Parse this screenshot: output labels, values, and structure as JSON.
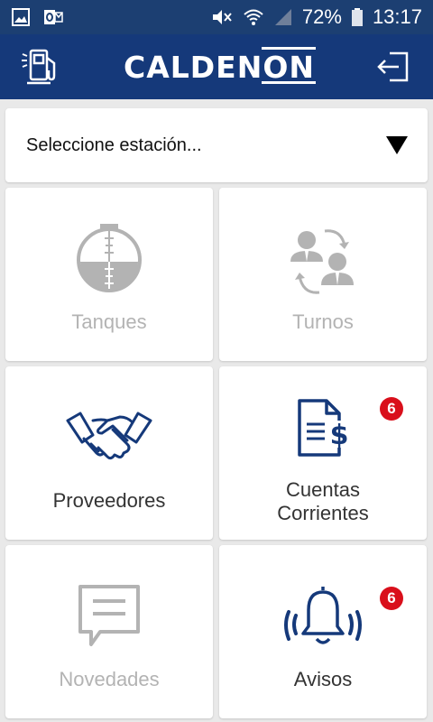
{
  "status_bar": {
    "battery": "72%",
    "time": "13:17",
    "icons": [
      "image-icon",
      "outlook-icon",
      "mute-icon",
      "wifi-icon",
      "signal-icon",
      "battery-icon"
    ]
  },
  "app_bar": {
    "brand_main": "CALDEN",
    "brand_suffix": "ON",
    "left_icon": "fuel-pump-icon",
    "right_icon": "logout-icon"
  },
  "station_select": {
    "placeholder": "Seleccione estación..."
  },
  "tiles": [
    {
      "label": "Tanques",
      "icon": "tank-gauge-icon",
      "enabled": false
    },
    {
      "label": "Turnos",
      "icon": "shift-swap-icon",
      "enabled": false
    },
    {
      "label": "Proveedores",
      "icon": "handshake-icon",
      "enabled": true
    },
    {
      "label_line1": "Cuentas",
      "label_line2": "Corrientes",
      "icon": "invoice-dollar-icon",
      "enabled": true,
      "badge": "6"
    },
    {
      "label": "Novedades",
      "icon": "message-icon",
      "enabled": false
    },
    {
      "label": "Avisos",
      "icon": "bell-ringing-icon",
      "enabled": true,
      "badge": "6"
    }
  ],
  "colors": {
    "status_bar": "#1c3f72",
    "app_bar": "#15397a",
    "icon_active": "#15397a",
    "icon_disabled": "#b3b3b3",
    "badge": "#d90f1b"
  }
}
